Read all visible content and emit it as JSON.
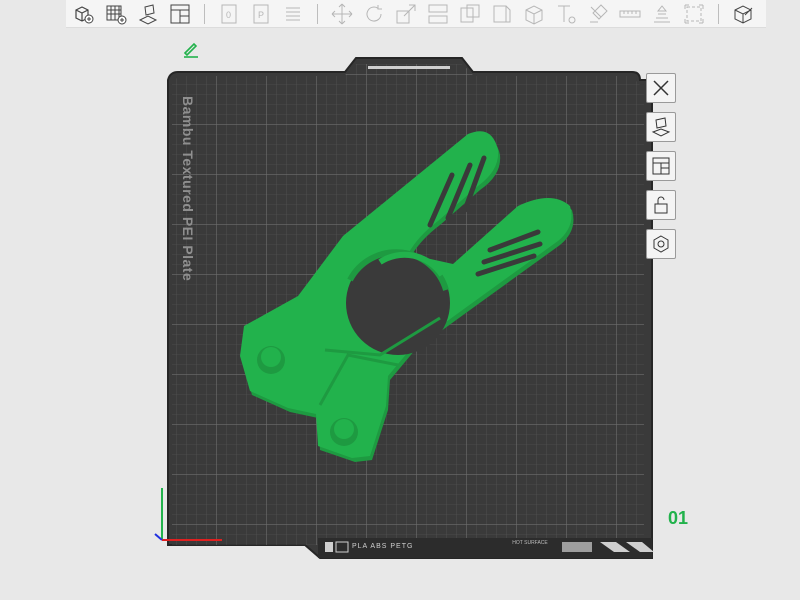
{
  "toolbar": {
    "groups": [
      [
        "add-cube-icon",
        "arrange-grid-icon",
        "orient-icon",
        "layout-icon"
      ],
      [
        "plate-icon",
        "plate-p-icon",
        "lines-icon"
      ],
      [
        "move-icon",
        "rotate-icon",
        "scale-icon",
        "split-icon",
        "cut-icon",
        "paint-icon",
        "support-icon",
        "text-icon",
        "brush-icon",
        "measure-icon",
        "assembly-icon",
        "view-icon"
      ],
      [
        "cube-tool-icon"
      ]
    ]
  },
  "plate": {
    "name": "Bambu Textured PEI Plate",
    "number": "01",
    "bottom_label": "PLA ABS PETG",
    "surface_label": "HOT SURFACE"
  },
  "colors": {
    "model": "#22b24c",
    "plate": "#3b3b3b",
    "accent": "#21b24b"
  },
  "side_tools": [
    {
      "name": "close-icon"
    },
    {
      "name": "auto-orient-icon"
    },
    {
      "name": "arrange-icon"
    },
    {
      "name": "lock-icon"
    },
    {
      "name": "settings-icon"
    }
  ]
}
